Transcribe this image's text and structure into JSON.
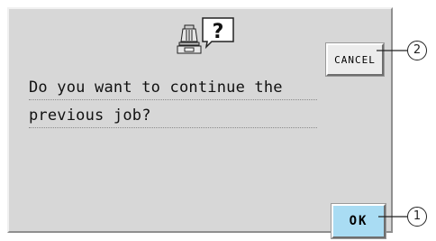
{
  "dialog": {
    "icon": "sewing-machine-question-icon",
    "message_lines": [
      "Do you want to continue the",
      "previous job?"
    ]
  },
  "buttons": {
    "cancel_label": "CANCEL",
    "ok_label": "OK"
  },
  "callouts": {
    "cancel": "2",
    "ok": "1"
  },
  "colors": {
    "panel_bg": "#d7d7d7",
    "ok_button_bg": "#a9dcf3",
    "cancel_button_bg": "#ececec"
  }
}
